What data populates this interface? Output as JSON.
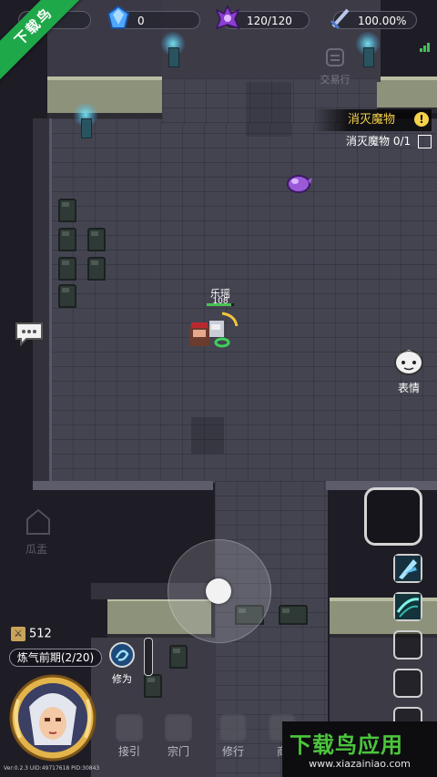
{
  "banner": {
    "text": "下载鸟"
  },
  "resources": [
    {
      "name": "gem",
      "value": "0",
      "icon": "blue-crystal-icon"
    },
    {
      "name": "energy",
      "value": "120/120",
      "icon": "purple-demon-icon"
    },
    {
      "name": "exp",
      "value": "100.00%",
      "icon": "sword-icon"
    }
  ],
  "trade": {
    "label": "交易行"
  },
  "quest": {
    "title": "消灭魔物",
    "objective": "消灭魔物",
    "progress": "0/1"
  },
  "player": {
    "name": "乐瑶",
    "hp": "108",
    "hp_fraction": 0.9
  },
  "emote": {
    "label": "表情"
  },
  "bottom": {
    "power": "512",
    "realm": "炼气前期(2/20)",
    "cultivate": "修为",
    "version": "Ver:0.2.3     UID:49717618     PID:30843"
  },
  "background_labels": {
    "left_house": "瓜盂"
  },
  "nav": [
    {
      "label": "接引",
      "icon": "summon-icon"
    },
    {
      "label": "宗门",
      "icon": "sect-icon"
    },
    {
      "label": "修行",
      "icon": "practice-icon"
    },
    {
      "label": "商",
      "icon": "shop-icon"
    }
  ],
  "watermark": {
    "title": "下载鸟应用",
    "url": "www.xiazainiao.com"
  },
  "colors": {
    "accent_gold": "#f5d24a",
    "torch_cyan": "#78f0ff",
    "banner_green": "#1fa84a",
    "watermark_green": "#4cc53d"
  }
}
